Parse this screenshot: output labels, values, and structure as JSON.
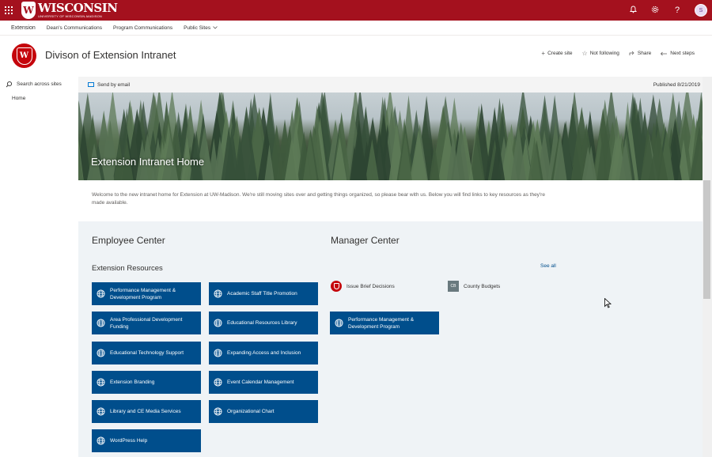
{
  "suite": {
    "brand_letter": "W",
    "brand_big": "WISCONSIN",
    "brand_small": "UNIVERSITY OF WISCONSIN-MADISON",
    "avatar_initials": "S",
    "help_glyph": "?"
  },
  "hubnav": {
    "title": "Extension",
    "items": [
      "Dean's Communications",
      "Program Communications",
      "Public Sites"
    ]
  },
  "site": {
    "title": "Divison of Extension Intranet",
    "actions": {
      "create": "Create site",
      "follow": "Not following",
      "share": "Share",
      "next": "Next steps"
    }
  },
  "leftnav": {
    "search_placeholder": "Search across sites",
    "home": "Home"
  },
  "commandbar": {
    "send": "Send by email",
    "published": "Published 8/21/2019"
  },
  "hero": {
    "title": "Extension Intranet Home"
  },
  "welcome": {
    "text": "Welcome to the new intranet home for Extension at UW-Madison. We're still moving sites over and getting things organized, so please bear with us. Below you will find links to key resources as they're made available."
  },
  "employee": {
    "title": "Employee Center",
    "subtitle": "Extension Resources",
    "col1": [
      "Performance Management & Development Program",
      "Area Professional Development Funding",
      "Educational Technology Support",
      "Extension Branding",
      "Library and CE Media Services",
      "WordPress Help"
    ],
    "col2": [
      "Academic Staff Title Promotion",
      "Educational Resources Library",
      "Expanding Access and Inclusion",
      "Event Calendar Management",
      "Organizational Chart"
    ]
  },
  "manager": {
    "title": "Manager Center",
    "see_all": "See all",
    "links": [
      "Issue Brief Decisions",
      "County Budgets"
    ],
    "cb_abbr": "CB",
    "tile": "Performance Management & Development Program"
  },
  "colors": {
    "suite_red": "#a4111e",
    "tile_blue": "#004e8c",
    "section_bg": "#eff3f6"
  }
}
